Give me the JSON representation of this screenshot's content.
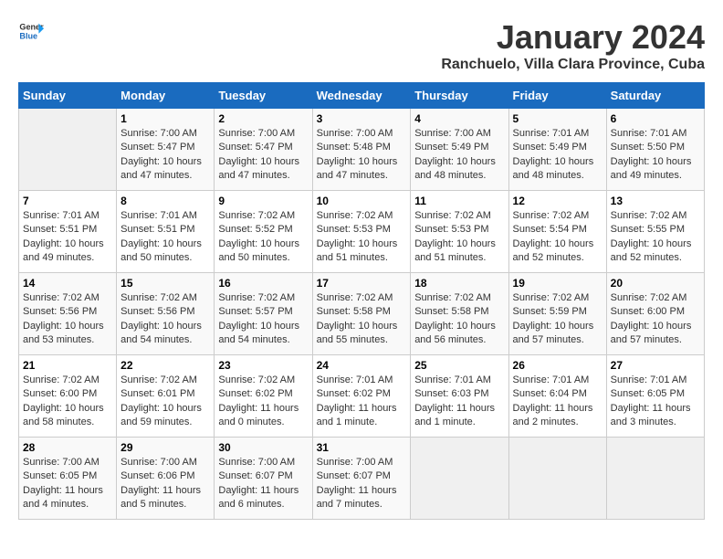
{
  "logo": {
    "general": "General",
    "blue": "Blue"
  },
  "title": "January 2024",
  "location": "Ranchuelo, Villa Clara Province, Cuba",
  "days_of_week": [
    "Sunday",
    "Monday",
    "Tuesday",
    "Wednesday",
    "Thursday",
    "Friday",
    "Saturday"
  ],
  "weeks": [
    [
      {
        "day": "",
        "sunrise": "",
        "sunset": "",
        "daylight": ""
      },
      {
        "day": "1",
        "sunrise": "Sunrise: 7:00 AM",
        "sunset": "Sunset: 5:47 PM",
        "daylight": "Daylight: 10 hours and 47 minutes."
      },
      {
        "day": "2",
        "sunrise": "Sunrise: 7:00 AM",
        "sunset": "Sunset: 5:47 PM",
        "daylight": "Daylight: 10 hours and 47 minutes."
      },
      {
        "day": "3",
        "sunrise": "Sunrise: 7:00 AM",
        "sunset": "Sunset: 5:48 PM",
        "daylight": "Daylight: 10 hours and 47 minutes."
      },
      {
        "day": "4",
        "sunrise": "Sunrise: 7:00 AM",
        "sunset": "Sunset: 5:49 PM",
        "daylight": "Daylight: 10 hours and 48 minutes."
      },
      {
        "day": "5",
        "sunrise": "Sunrise: 7:01 AM",
        "sunset": "Sunset: 5:49 PM",
        "daylight": "Daylight: 10 hours and 48 minutes."
      },
      {
        "day": "6",
        "sunrise": "Sunrise: 7:01 AM",
        "sunset": "Sunset: 5:50 PM",
        "daylight": "Daylight: 10 hours and 49 minutes."
      }
    ],
    [
      {
        "day": "7",
        "sunrise": "Sunrise: 7:01 AM",
        "sunset": "Sunset: 5:51 PM",
        "daylight": "Daylight: 10 hours and 49 minutes."
      },
      {
        "day": "8",
        "sunrise": "Sunrise: 7:01 AM",
        "sunset": "Sunset: 5:51 PM",
        "daylight": "Daylight: 10 hours and 50 minutes."
      },
      {
        "day": "9",
        "sunrise": "Sunrise: 7:02 AM",
        "sunset": "Sunset: 5:52 PM",
        "daylight": "Daylight: 10 hours and 50 minutes."
      },
      {
        "day": "10",
        "sunrise": "Sunrise: 7:02 AM",
        "sunset": "Sunset: 5:53 PM",
        "daylight": "Daylight: 10 hours and 51 minutes."
      },
      {
        "day": "11",
        "sunrise": "Sunrise: 7:02 AM",
        "sunset": "Sunset: 5:53 PM",
        "daylight": "Daylight: 10 hours and 51 minutes."
      },
      {
        "day": "12",
        "sunrise": "Sunrise: 7:02 AM",
        "sunset": "Sunset: 5:54 PM",
        "daylight": "Daylight: 10 hours and 52 minutes."
      },
      {
        "day": "13",
        "sunrise": "Sunrise: 7:02 AM",
        "sunset": "Sunset: 5:55 PM",
        "daylight": "Daylight: 10 hours and 52 minutes."
      }
    ],
    [
      {
        "day": "14",
        "sunrise": "Sunrise: 7:02 AM",
        "sunset": "Sunset: 5:56 PM",
        "daylight": "Daylight: 10 hours and 53 minutes."
      },
      {
        "day": "15",
        "sunrise": "Sunrise: 7:02 AM",
        "sunset": "Sunset: 5:56 PM",
        "daylight": "Daylight: 10 hours and 54 minutes."
      },
      {
        "day": "16",
        "sunrise": "Sunrise: 7:02 AM",
        "sunset": "Sunset: 5:57 PM",
        "daylight": "Daylight: 10 hours and 54 minutes."
      },
      {
        "day": "17",
        "sunrise": "Sunrise: 7:02 AM",
        "sunset": "Sunset: 5:58 PM",
        "daylight": "Daylight: 10 hours and 55 minutes."
      },
      {
        "day": "18",
        "sunrise": "Sunrise: 7:02 AM",
        "sunset": "Sunset: 5:58 PM",
        "daylight": "Daylight: 10 hours and 56 minutes."
      },
      {
        "day": "19",
        "sunrise": "Sunrise: 7:02 AM",
        "sunset": "Sunset: 5:59 PM",
        "daylight": "Daylight: 10 hours and 57 minutes."
      },
      {
        "day": "20",
        "sunrise": "Sunrise: 7:02 AM",
        "sunset": "Sunset: 6:00 PM",
        "daylight": "Daylight: 10 hours and 57 minutes."
      }
    ],
    [
      {
        "day": "21",
        "sunrise": "Sunrise: 7:02 AM",
        "sunset": "Sunset: 6:00 PM",
        "daylight": "Daylight: 10 hours and 58 minutes."
      },
      {
        "day": "22",
        "sunrise": "Sunrise: 7:02 AM",
        "sunset": "Sunset: 6:01 PM",
        "daylight": "Daylight: 10 hours and 59 minutes."
      },
      {
        "day": "23",
        "sunrise": "Sunrise: 7:02 AM",
        "sunset": "Sunset: 6:02 PM",
        "daylight": "Daylight: 11 hours and 0 minutes."
      },
      {
        "day": "24",
        "sunrise": "Sunrise: 7:01 AM",
        "sunset": "Sunset: 6:02 PM",
        "daylight": "Daylight: 11 hours and 1 minute."
      },
      {
        "day": "25",
        "sunrise": "Sunrise: 7:01 AM",
        "sunset": "Sunset: 6:03 PM",
        "daylight": "Daylight: 11 hours and 1 minute."
      },
      {
        "day": "26",
        "sunrise": "Sunrise: 7:01 AM",
        "sunset": "Sunset: 6:04 PM",
        "daylight": "Daylight: 11 hours and 2 minutes."
      },
      {
        "day": "27",
        "sunrise": "Sunrise: 7:01 AM",
        "sunset": "Sunset: 6:05 PM",
        "daylight": "Daylight: 11 hours and 3 minutes."
      }
    ],
    [
      {
        "day": "28",
        "sunrise": "Sunrise: 7:00 AM",
        "sunset": "Sunset: 6:05 PM",
        "daylight": "Daylight: 11 hours and 4 minutes."
      },
      {
        "day": "29",
        "sunrise": "Sunrise: 7:00 AM",
        "sunset": "Sunset: 6:06 PM",
        "daylight": "Daylight: 11 hours and 5 minutes."
      },
      {
        "day": "30",
        "sunrise": "Sunrise: 7:00 AM",
        "sunset": "Sunset: 6:07 PM",
        "daylight": "Daylight: 11 hours and 6 minutes."
      },
      {
        "day": "31",
        "sunrise": "Sunrise: 7:00 AM",
        "sunset": "Sunset: 6:07 PM",
        "daylight": "Daylight: 11 hours and 7 minutes."
      },
      {
        "day": "",
        "sunrise": "",
        "sunset": "",
        "daylight": ""
      },
      {
        "day": "",
        "sunrise": "",
        "sunset": "",
        "daylight": ""
      },
      {
        "day": "",
        "sunrise": "",
        "sunset": "",
        "daylight": ""
      }
    ]
  ]
}
